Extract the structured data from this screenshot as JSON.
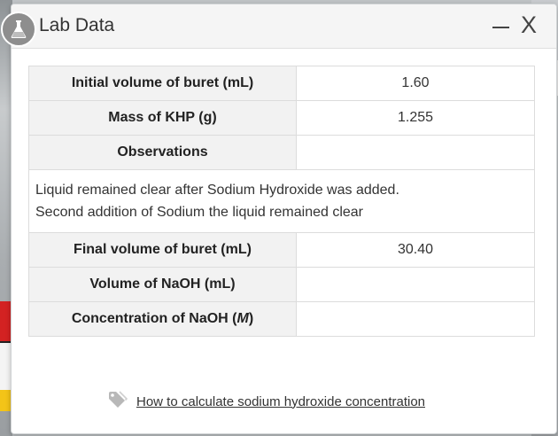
{
  "window": {
    "title": "Lab Data",
    "minimize_icon": "minimize-icon",
    "close_label": "X"
  },
  "table": {
    "rows_top": [
      {
        "label": "Initial volume of buret (mL)",
        "value": "1.60"
      },
      {
        "label": "Mass of KHP (g)",
        "value": "1.255"
      }
    ],
    "observations": {
      "label": "Observations",
      "lines": [
        "Liquid remained clear after Sodium Hydroxide was added.",
        "Second addition of Sodium the liquid remained clear"
      ]
    },
    "rows_bottom": [
      {
        "label": "Final volume of buret (mL)",
        "value": "30.40"
      },
      {
        "label": "Volume of NaOH (mL)",
        "value": ""
      }
    ],
    "concentration": {
      "label_prefix": "Concentration of NaOH (",
      "label_unit": "M",
      "label_suffix": ")",
      "value": ""
    }
  },
  "help_link": {
    "icon": "tag-icon",
    "label": "How to calculate sodium hydroxide concentration"
  },
  "colors": {
    "header_cell_bg": "#f2f2f2",
    "title_icon_bg": "#8e8e8e"
  }
}
